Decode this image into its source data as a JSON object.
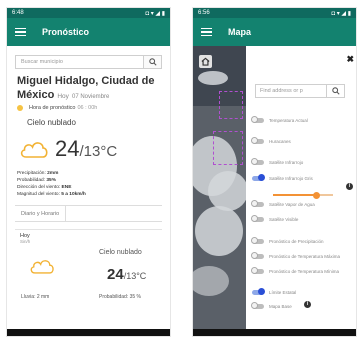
{
  "left_phone": {
    "status": {
      "time": "6:48",
      "icons": "◘ ▾ ◢ ▮"
    },
    "appbar": {
      "title": "Pronóstico"
    },
    "search": {
      "placeholder": "Buscar municipio"
    },
    "city": {
      "name": "Miguel Hidalgo, Ciudad de México",
      "date_label": "Hoy",
      "date_value": "07 Noviembre"
    },
    "forecast_hour": {
      "label": "Hora de pronóstico",
      "value": "06 : 00h"
    },
    "condition": "Cielo nublado",
    "temperature": {
      "value": "24",
      "unit": "/13°C"
    },
    "details": [
      {
        "label": "Precipitación:",
        "value": "2mm"
      },
      {
        "label": "Probabilidad:",
        "value": "35%"
      },
      {
        "label": "Dirección del viento:",
        "value": "ENE"
      },
      {
        "label": "Magnitud del viento:",
        "value": "5 a 10km/h"
      }
    ],
    "tabs": [
      "Diario y Horario"
    ],
    "card": {
      "day": "Hoy",
      "subtitle": "Sin/h",
      "condition": "Cielo nublado",
      "temp": "24",
      "unit": "/13°C",
      "rain_label": "Lluvia: 2 mm",
      "probability_label": "Probabilidad: 35 %"
    }
  },
  "right_phone": {
    "status": {
      "time": "6:56",
      "icons": "◘ ▾ ◢ ▮"
    },
    "appbar": {
      "title": "Mapa"
    },
    "address": {
      "placeholder": "Find address or p"
    },
    "layers": [
      {
        "label": "Temperatura Actual",
        "on": false
      },
      {
        "label": "Huracanes",
        "on": false
      },
      {
        "label": "Satélite Infrarrojo",
        "on": false
      },
      {
        "label": "Satélite Infrarrojo Gris",
        "on": true
      },
      {
        "label": "Satélite Vapor de Agua",
        "on": false
      },
      {
        "label": "Satélite Visible",
        "on": false
      },
      {
        "label": "Pronóstico de Precipitación",
        "on": false
      },
      {
        "label": "Pronóstico de Temperatura Máxima",
        "on": false
      },
      {
        "label": "Pronóstico de Temperatura Mínima",
        "on": false
      },
      {
        "label": "Límite Estatal",
        "on": true
      },
      {
        "label": "Mapa Base",
        "on": false
      }
    ],
    "opacity_slider": {
      "value_fraction": 0.72
    },
    "colors": {
      "accent": "#13826f",
      "status": "#0f6a5f",
      "slider": "#f39235",
      "toggle_on": "#2a4fd6"
    }
  }
}
